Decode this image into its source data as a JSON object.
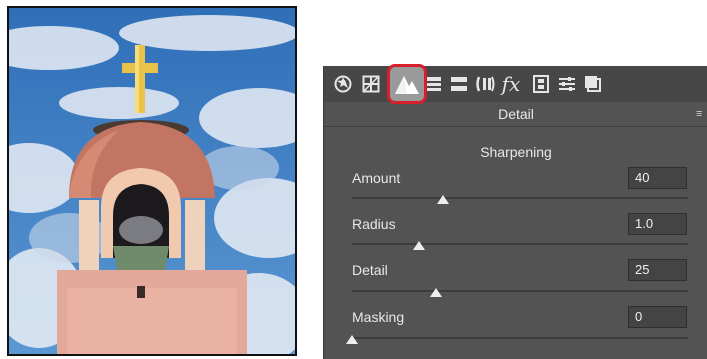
{
  "toolbar": {
    "icons": [
      "aperture-icon",
      "grid-icon",
      "detail-icon",
      "hsl-icon",
      "split-toning-icon",
      "lens-icon",
      "fx-icon",
      "camera-calibration-icon",
      "presets-icon",
      "snapshots-icon"
    ],
    "active": "detail-icon",
    "fx_label": "fx"
  },
  "panel": {
    "title": "Detail",
    "menu_glyph": "≡",
    "section": "Sharpening"
  },
  "sliders": [
    {
      "label": "Amount",
      "value": "40",
      "fraction": 0.27
    },
    {
      "label": "Radius",
      "value": "1.0",
      "fraction": 0.2
    },
    {
      "label": "Detail",
      "value": "25",
      "fraction": 0.25
    },
    {
      "label": "Masking",
      "value": "0",
      "fraction": 0.0
    }
  ],
  "colors": {
    "highlight": "#d4202b",
    "panel_bg": "#535353",
    "sky": "#3f82c9"
  }
}
